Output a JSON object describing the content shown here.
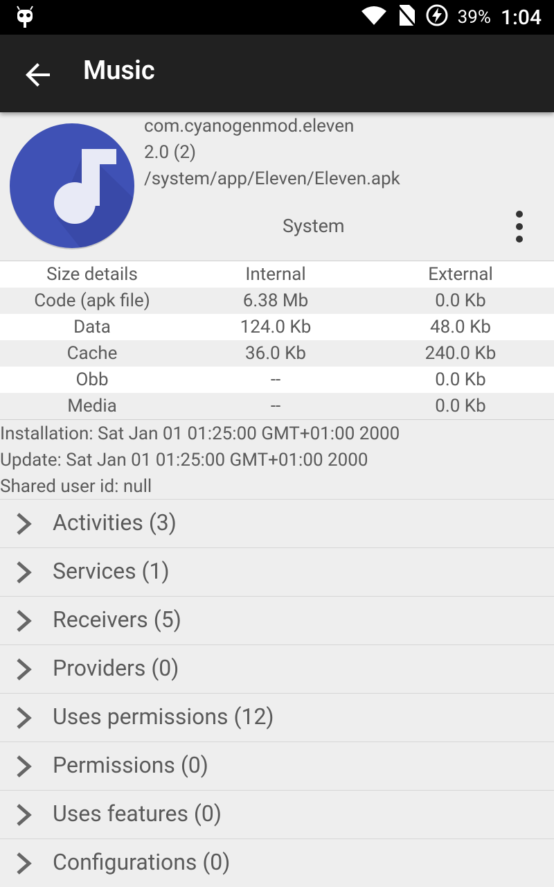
{
  "status_bar": {
    "battery": "39%",
    "time": "1:04"
  },
  "app_bar": {
    "title": "Music"
  },
  "app_info": {
    "package": "com.cyanogenmod.eleven",
    "version": "2.0 (2)",
    "path": "/system/app/Eleven/Eleven.apk",
    "type": "System"
  },
  "size_table": {
    "headers": [
      "Size details",
      "Internal",
      "External"
    ],
    "rows": [
      [
        "Code (apk file)",
        "6.38 Mb",
        "0.0 Kb"
      ],
      [
        "Data",
        "124.0 Kb",
        "48.0 Kb"
      ],
      [
        "Cache",
        "36.0 Kb",
        "240.0 Kb"
      ],
      [
        "Obb",
        "--",
        "0.0 Kb"
      ],
      [
        "Media",
        "--",
        "0.0 Kb"
      ]
    ]
  },
  "details": {
    "installation": "Installation: Sat Jan 01 01:25:00 GMT+01:00 2000",
    "update": "Update: Sat Jan 01 01:25:00 GMT+01:00 2000",
    "shared_user_id": "Shared user id: null"
  },
  "sections": [
    "Activities (3)",
    "Services (1)",
    "Receivers (5)",
    "Providers (0)",
    "Uses permissions (12)",
    "Permissions (0)",
    "Uses features (0)",
    "Configurations (0)"
  ],
  "colors": {
    "app_bar": "#212121",
    "icon_blue": "#3f51b5",
    "background": "#eeeeee"
  }
}
